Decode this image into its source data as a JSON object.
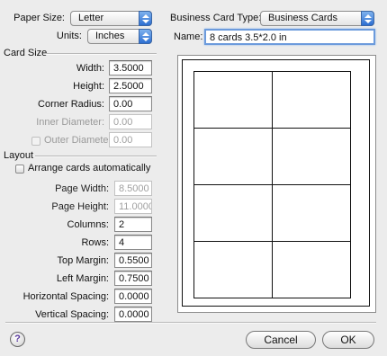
{
  "paper_size": {
    "label": "Paper Size:",
    "value": "Letter"
  },
  "units": {
    "label": "Units:",
    "value": "Inches"
  },
  "card_type": {
    "label": "Business Card Type:",
    "value": "Business Cards"
  },
  "name_field": {
    "label": "Name:",
    "value": "8 cards 3.5*2.0 in"
  },
  "card_size": {
    "title": "Card Size",
    "width": {
      "label": "Width:",
      "value": "3.5000"
    },
    "height": {
      "label": "Height:",
      "value": "2.5000"
    },
    "corner_radius": {
      "label": "Corner Radius:",
      "value": "0.00"
    },
    "inner_diameter": {
      "label": "Inner Diameter:",
      "value": "0.00"
    },
    "outer_diameter": {
      "label": "Outer Diameter:",
      "value": "0.00"
    }
  },
  "layout": {
    "title": "Layout",
    "arrange_auto": {
      "label": "Arrange cards automatically",
      "checked": false
    },
    "page_width": {
      "label": "Page Width:",
      "value": "8.5000"
    },
    "page_height": {
      "label": "Page Height:",
      "value": "11.0000"
    },
    "columns": {
      "label": "Columns:",
      "value": "2"
    },
    "rows": {
      "label": "Rows:",
      "value": "4"
    },
    "top_margin": {
      "label": "Top Margin:",
      "value": "0.5500"
    },
    "left_margin": {
      "label": "Left Margin:",
      "value": "0.7500"
    },
    "horizontal_spacing": {
      "label": "Horizontal Spacing:",
      "value": "0.0000"
    },
    "vertical_spacing": {
      "label": "Vertical Spacing:",
      "value": "0.0000"
    }
  },
  "preview": {
    "columns": 2,
    "rows": 4
  },
  "buttons": {
    "help": "?",
    "cancel": "Cancel",
    "ok": "OK"
  }
}
